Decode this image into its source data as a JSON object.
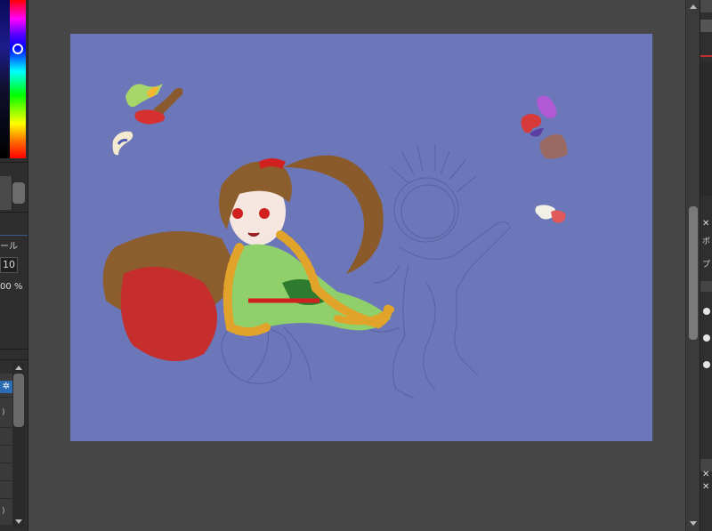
{
  "left_panel": {
    "tool_label": "ール",
    "brush_size": "10",
    "opacity": "00 %",
    "list_paren_1": ")",
    "list_paren_2": ")",
    "gear_icon": "gear-icon"
  },
  "right_panel": {
    "close_1": "✕",
    "close_2": "✕",
    "close_3": "✕",
    "label_1": "ポ",
    "label_2": "プ"
  },
  "colors": {
    "canvas_bg": "#6b77b8",
    "workspace_bg": "#474747",
    "panel_bg": "#2e2e2e",
    "accent_selected": "#2b6cb3"
  }
}
